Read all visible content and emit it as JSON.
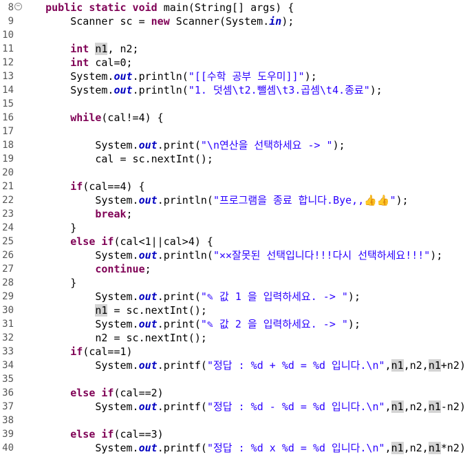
{
  "editor": {
    "lines": [
      {
        "num": "8",
        "fold": "⊖",
        "segs": [
          {
            "t": "    "
          },
          {
            "t": "public static void",
            "c": "kw"
          },
          {
            "t": " main(String[] args) {"
          }
        ]
      },
      {
        "num": "9",
        "segs": [
          {
            "t": "        Scanner sc = "
          },
          {
            "t": "new",
            "c": "kw"
          },
          {
            "t": " Scanner(System."
          },
          {
            "t": "in",
            "c": "fld"
          },
          {
            "t": ");"
          }
        ]
      },
      {
        "num": "10",
        "segs": []
      },
      {
        "num": "11",
        "segs": [
          {
            "t": "        "
          },
          {
            "t": "int",
            "c": "kw"
          },
          {
            "t": " "
          },
          {
            "t": "n1",
            "c": "hl"
          },
          {
            "t": ", n2;"
          }
        ]
      },
      {
        "num": "12",
        "segs": [
          {
            "t": "        "
          },
          {
            "t": "int",
            "c": "kw"
          },
          {
            "t": " cal=0;"
          }
        ]
      },
      {
        "num": "13",
        "segs": [
          {
            "t": "        System."
          },
          {
            "t": "out",
            "c": "fld"
          },
          {
            "t": ".println("
          },
          {
            "t": "\"[[수학 공부 도우미]]\"",
            "c": "str"
          },
          {
            "t": ");"
          }
        ]
      },
      {
        "num": "14",
        "segs": [
          {
            "t": "        System."
          },
          {
            "t": "out",
            "c": "fld"
          },
          {
            "t": ".println("
          },
          {
            "t": "\"1. 덧셈\\t2.뺄셈\\t3.곱셈\\t4.종료\"",
            "c": "str"
          },
          {
            "t": ");"
          }
        ]
      },
      {
        "num": "15",
        "segs": []
      },
      {
        "num": "16",
        "segs": [
          {
            "t": "        "
          },
          {
            "t": "while",
            "c": "kw"
          },
          {
            "t": "(cal!=4) {"
          }
        ]
      },
      {
        "num": "17",
        "segs": []
      },
      {
        "num": "18",
        "segs": [
          {
            "t": "            System."
          },
          {
            "t": "out",
            "c": "fld"
          },
          {
            "t": ".print("
          },
          {
            "t": "\"\\n연산을 선택하세요 -> \"",
            "c": "str"
          },
          {
            "t": ");"
          }
        ]
      },
      {
        "num": "19",
        "segs": [
          {
            "t": "            cal = sc.nextInt();"
          }
        ]
      },
      {
        "num": "20",
        "segs": []
      },
      {
        "num": "21",
        "segs": [
          {
            "t": "        "
          },
          {
            "t": "if",
            "c": "kw"
          },
          {
            "t": "(cal==4) {"
          }
        ]
      },
      {
        "num": "22",
        "segs": [
          {
            "t": "            System."
          },
          {
            "t": "out",
            "c": "fld"
          },
          {
            "t": ".println("
          },
          {
            "t": "\"프로그램을 종료 합니다.Bye,,👍👍\"",
            "c": "str"
          },
          {
            "t": ");"
          }
        ]
      },
      {
        "num": "23",
        "segs": [
          {
            "t": "            "
          },
          {
            "t": "break",
            "c": "kw"
          },
          {
            "t": ";"
          }
        ]
      },
      {
        "num": "24",
        "segs": [
          {
            "t": "        }"
          }
        ]
      },
      {
        "num": "25",
        "segs": [
          {
            "t": "        "
          },
          {
            "t": "else if",
            "c": "kw"
          },
          {
            "t": "(cal<1||cal>4) {"
          }
        ]
      },
      {
        "num": "26",
        "segs": [
          {
            "t": "            System."
          },
          {
            "t": "out",
            "c": "fld"
          },
          {
            "t": ".println("
          },
          {
            "t": "\"✕✕잘못된 선택입니다!!!다시 선택하세요!!!\"",
            "c": "str"
          },
          {
            "t": ");"
          }
        ]
      },
      {
        "num": "27",
        "segs": [
          {
            "t": "            "
          },
          {
            "t": "continue",
            "c": "kw"
          },
          {
            "t": ";"
          }
        ]
      },
      {
        "num": "28",
        "segs": [
          {
            "t": "        }"
          }
        ]
      },
      {
        "num": "29",
        "segs": [
          {
            "t": "            System."
          },
          {
            "t": "out",
            "c": "fld"
          },
          {
            "t": ".print("
          },
          {
            "t": "\"✎ 값 1 을 입력하세요. -> \"",
            "c": "str"
          },
          {
            "t": ");"
          }
        ]
      },
      {
        "num": "30",
        "segs": [
          {
            "t": "            "
          },
          {
            "t": "n1",
            "c": "hl"
          },
          {
            "t": " = sc.nextInt();"
          }
        ]
      },
      {
        "num": "31",
        "segs": [
          {
            "t": "            System."
          },
          {
            "t": "out",
            "c": "fld"
          },
          {
            "t": ".print("
          },
          {
            "t": "\"✎ 값 2 을 입력하세요. -> \"",
            "c": "str"
          },
          {
            "t": ");"
          }
        ]
      },
      {
        "num": "32",
        "segs": [
          {
            "t": "            n2 = sc.nextInt();"
          }
        ]
      },
      {
        "num": "33",
        "segs": [
          {
            "t": "        "
          },
          {
            "t": "if",
            "c": "kw"
          },
          {
            "t": "(cal==1)"
          }
        ]
      },
      {
        "num": "34",
        "segs": [
          {
            "t": "            System."
          },
          {
            "t": "out",
            "c": "fld"
          },
          {
            "t": ".printf("
          },
          {
            "t": "\"정답 : %d + %d = %d 입니다.\\n\"",
            "c": "str"
          },
          {
            "t": ","
          },
          {
            "t": "n1",
            "c": "hl"
          },
          {
            "t": ",n2,"
          },
          {
            "t": "n1",
            "c": "hl"
          },
          {
            "t": "+n2);"
          }
        ]
      },
      {
        "num": "35",
        "segs": []
      },
      {
        "num": "36",
        "segs": [
          {
            "t": "        "
          },
          {
            "t": "else if",
            "c": "kw"
          },
          {
            "t": "(cal==2)"
          }
        ]
      },
      {
        "num": "37",
        "segs": [
          {
            "t": "            System."
          },
          {
            "t": "out",
            "c": "fld"
          },
          {
            "t": ".printf("
          },
          {
            "t": "\"정답 : %d - %d = %d 입니다.\\n\"",
            "c": "str"
          },
          {
            "t": ","
          },
          {
            "t": "n1",
            "c": "hl"
          },
          {
            "t": ",n2,"
          },
          {
            "t": "n1",
            "c": "hl"
          },
          {
            "t": "-n2);"
          }
        ]
      },
      {
        "num": "38",
        "segs": []
      },
      {
        "num": "39",
        "segs": [
          {
            "t": "        "
          },
          {
            "t": "else if",
            "c": "kw"
          },
          {
            "t": "(cal==3)"
          }
        ]
      },
      {
        "num": "40",
        "segs": [
          {
            "t": "            System."
          },
          {
            "t": "out",
            "c": "fld"
          },
          {
            "t": ".printf("
          },
          {
            "t": "\"정답 : %d x %d = %d 입니다.\\n\"",
            "c": "str"
          },
          {
            "t": ","
          },
          {
            "t": "n1",
            "c": "hl"
          },
          {
            "t": ",n2,"
          },
          {
            "t": "n1",
            "c": "hl"
          },
          {
            "t": "*n2);"
          }
        ]
      }
    ]
  }
}
